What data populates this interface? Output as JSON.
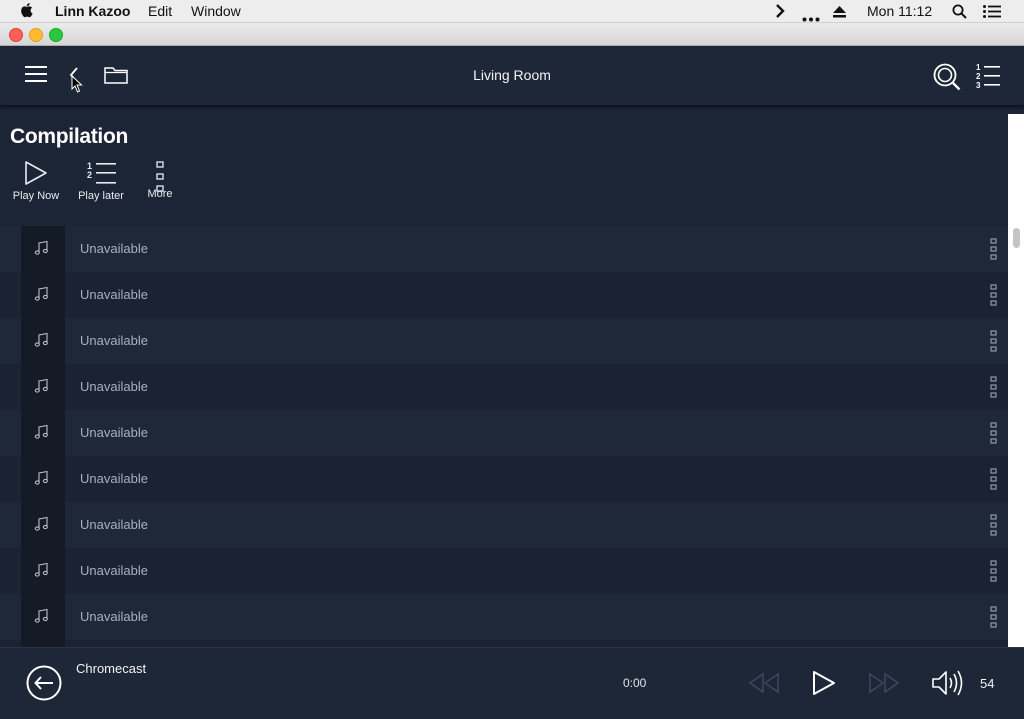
{
  "menubar": {
    "app_name": "Linn Kazoo",
    "menus": [
      "Edit",
      "Window"
    ],
    "clock": "Mon 11:12",
    "status_icons": [
      "chevron-right-icon",
      "ellipsis-icon",
      "eject-icon",
      "spotlight-search-icon",
      "notification-center-icon"
    ]
  },
  "window": {
    "traffic_lights": {
      "close": "#ff5f57",
      "minimize": "#febc2e",
      "zoom": "#28c840"
    }
  },
  "toolbar": {
    "room_name": "Living Room",
    "icons": [
      "hamburger-menu-icon",
      "back-chevron-icon",
      "folder-icon",
      "search-icon",
      "play-queue-icon"
    ]
  },
  "container": {
    "title": "Compilation",
    "actions": [
      {
        "label": "Play Now",
        "icon": "play-icon"
      },
      {
        "label": "Play later",
        "icon": "numbered-list-icon"
      },
      {
        "label": "More",
        "icon": "more-vertical-icon"
      }
    ]
  },
  "tracks": [
    {
      "title": "Unavailable"
    },
    {
      "title": "Unavailable"
    },
    {
      "title": "Unavailable"
    },
    {
      "title": "Unavailable"
    },
    {
      "title": "Unavailable"
    },
    {
      "title": "Unavailable"
    },
    {
      "title": "Unavailable"
    },
    {
      "title": "Unavailable"
    },
    {
      "title": "Unavailable"
    }
  ],
  "player": {
    "source_name": "Chromecast",
    "elapsed": "0:00",
    "volume": "54",
    "icons": [
      "source-exit-icon",
      "skip-back-icon",
      "play-icon",
      "skip-forward-icon",
      "speaker-volume-icon"
    ]
  },
  "colors": {
    "background": "#1c2535",
    "toolbar": "#1e2737",
    "text": "#ffffff",
    "muted_text": "#a8b0bd",
    "disabled_icon": "#3b475c"
  }
}
